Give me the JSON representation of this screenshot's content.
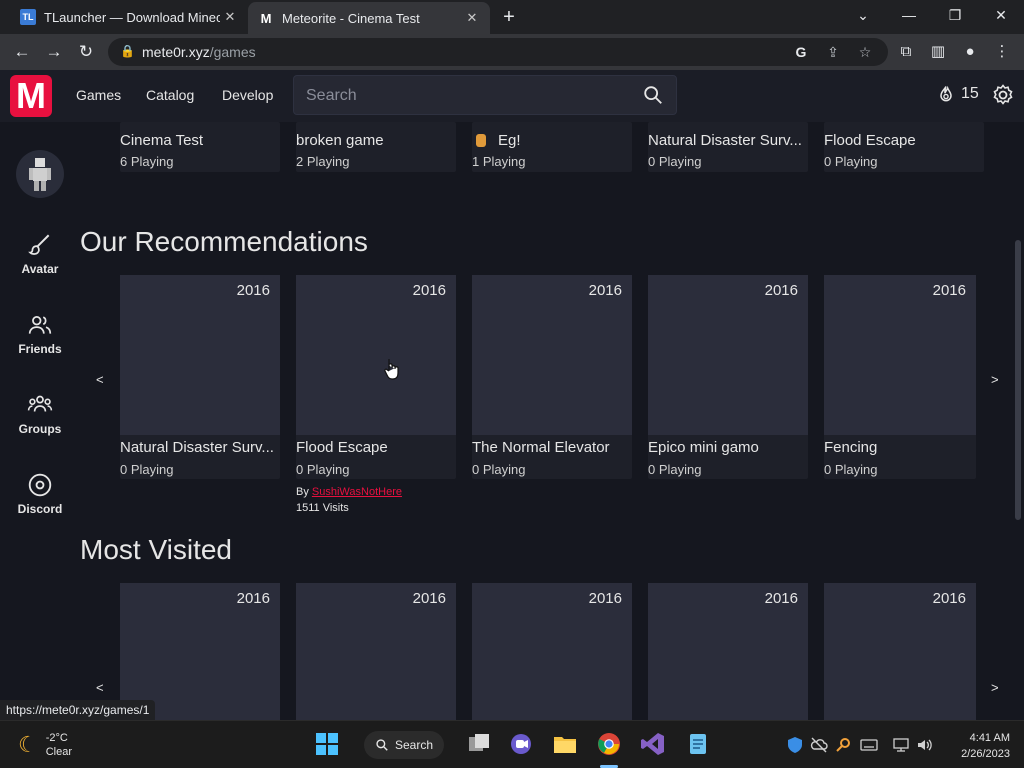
{
  "browser": {
    "tabs": [
      {
        "title": "TLauncher — Download Minecraft",
        "favicon": "TL"
      },
      {
        "title": "Meteorite - Cinema Test",
        "favicon": "M"
      }
    ],
    "url_host": "mete0r.xyz",
    "url_path": "/games",
    "status_url": "https://mete0r.xyz/games/1"
  },
  "header": {
    "logo": "M",
    "nav": [
      "Games",
      "Catalog",
      "Develop"
    ],
    "search_placeholder": "Search",
    "currency": "15"
  },
  "sidebar": {
    "items": [
      {
        "label": "Avatar",
        "icon": "brush-icon"
      },
      {
        "label": "Friends",
        "icon": "friends-icon"
      },
      {
        "label": "Groups",
        "icon": "groups-icon"
      },
      {
        "label": "Discord",
        "icon": "discord-icon"
      }
    ]
  },
  "top_row": [
    {
      "name": "Cinema Test",
      "players": "6 Playing"
    },
    {
      "name": "broken game",
      "players": "2 Playing"
    },
    {
      "name": "Eg!",
      "players": "1 Playing"
    },
    {
      "name": "Natural Disaster Surv...",
      "players": "0 Playing"
    },
    {
      "name": "Flood Escape",
      "players": "0 Playing"
    }
  ],
  "recommendations": {
    "title": "Our Recommendations",
    "prev": "<",
    "next": ">",
    "cards": [
      {
        "year": "2016",
        "name": "Natural Disaster Surv...",
        "players": "0 Playing"
      },
      {
        "year": "2016",
        "name": "Flood Escape",
        "players": "0 Playing"
      },
      {
        "year": "2016",
        "name": "The Normal Elevator",
        "players": "0 Playing"
      },
      {
        "year": "2016",
        "name": "Epico mini gamo",
        "players": "0 Playing"
      },
      {
        "year": "2016",
        "name": "Fencing",
        "players": "0 Playing"
      }
    ],
    "hover": {
      "by": "By",
      "creator": "SushiWasNotHere",
      "visits": "1511 Visits"
    }
  },
  "most_visited": {
    "title": "Most Visited",
    "prev": "<",
    "next": ">",
    "years": [
      "2016",
      "2016",
      "2016",
      "2016",
      "2016"
    ]
  },
  "taskbar": {
    "temperature": "-2°C",
    "condition": "Clear",
    "search_label": "Search",
    "time": "4:41 AM",
    "date": "2/26/2023"
  },
  "colors": {
    "brand": "#e8103f",
    "card_bg": "#2b2d3b",
    "page_bg": "#15171f"
  }
}
